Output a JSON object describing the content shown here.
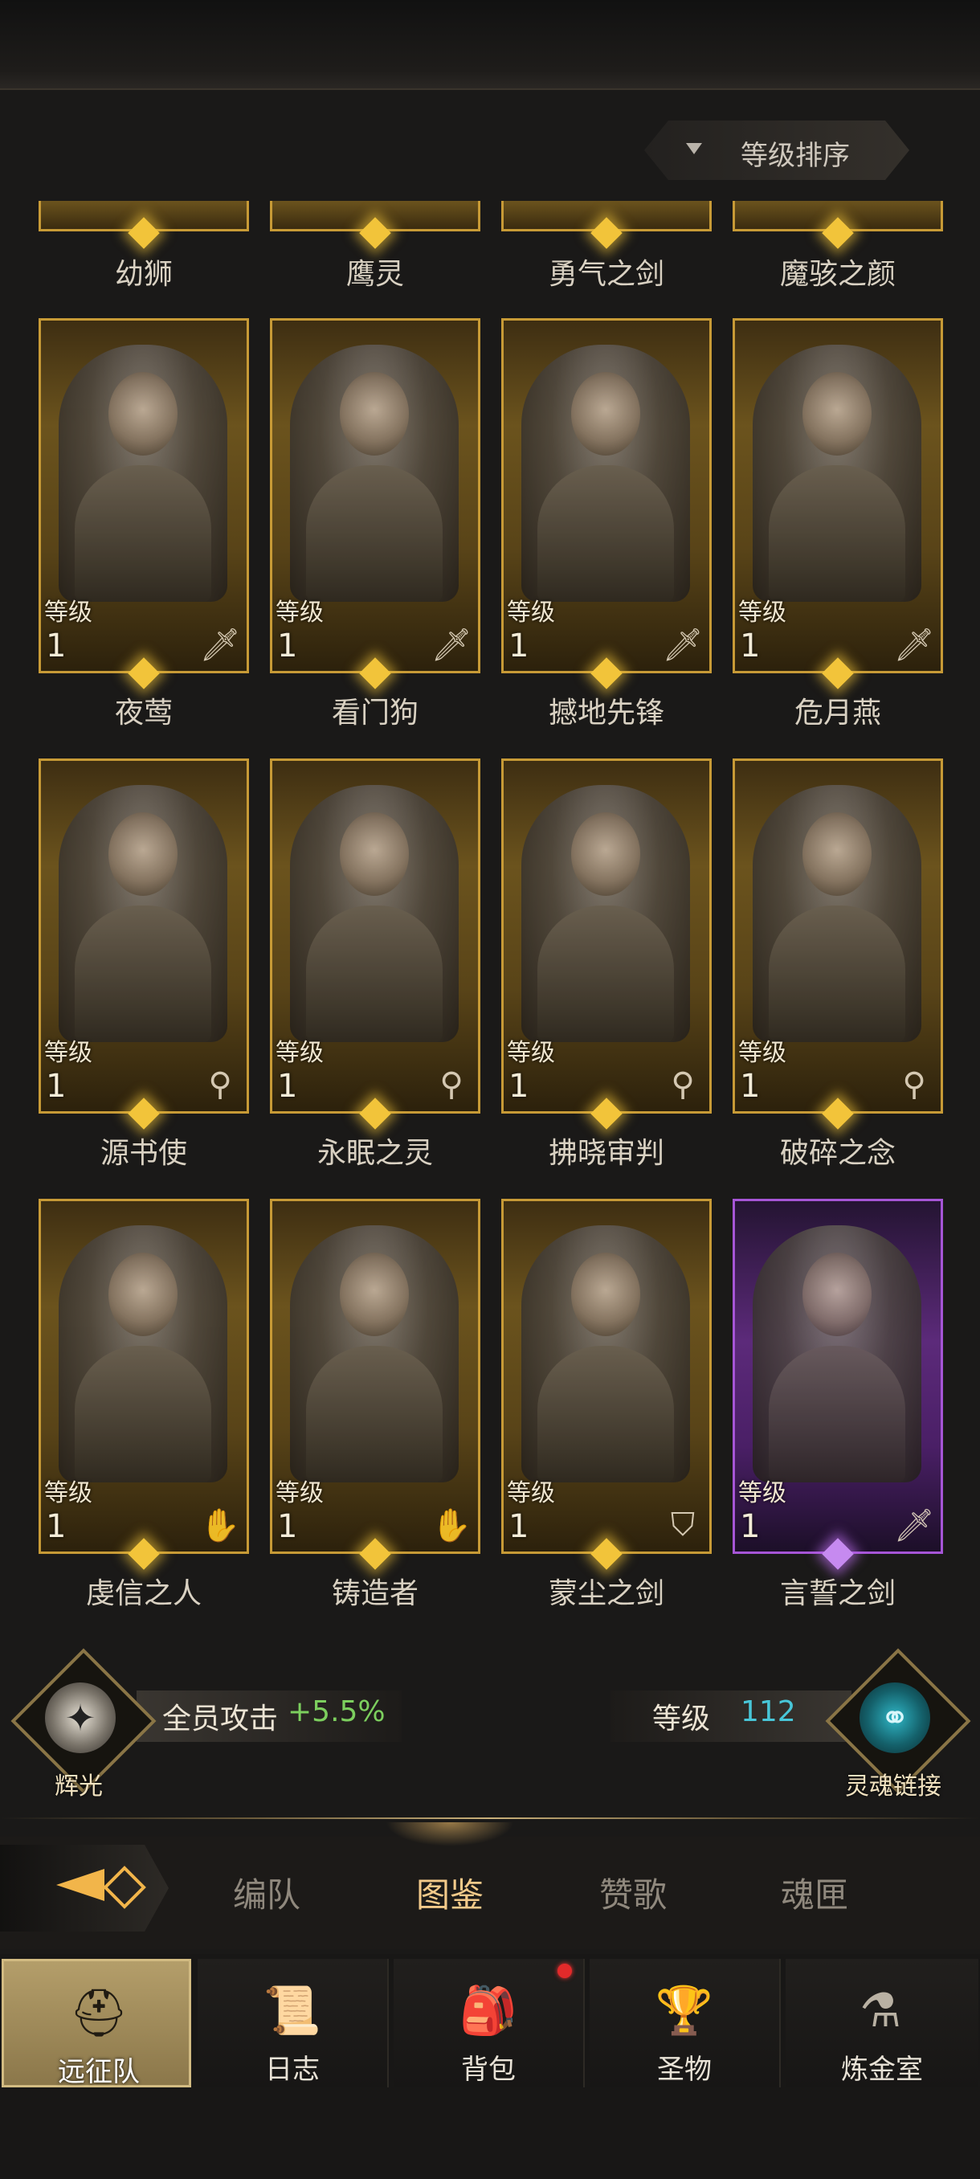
{
  "sort_button": {
    "label": "等级排序"
  },
  "partial_row": {
    "names": [
      "幼狮",
      "鹰灵",
      "勇气之剑",
      "魔骇之颜"
    ]
  },
  "level_label": "等级",
  "cards": [
    {
      "name": "夜莺",
      "level": "1",
      "class_icon": "sword-icon",
      "rarity": "gold"
    },
    {
      "name": "看门狗",
      "level": "1",
      "class_icon": "sword-icon",
      "rarity": "gold"
    },
    {
      "name": "撼地先锋",
      "level": "1",
      "class_icon": "sword-icon",
      "rarity": "gold"
    },
    {
      "name": "危月燕",
      "level": "1",
      "class_icon": "sword-icon",
      "rarity": "gold"
    },
    {
      "name": "源书使",
      "level": "1",
      "class_icon": "staff-icon",
      "rarity": "gold"
    },
    {
      "name": "永眠之灵",
      "level": "1",
      "class_icon": "staff-icon",
      "rarity": "gold"
    },
    {
      "name": "拂晓审判",
      "level": "1",
      "class_icon": "staff-icon",
      "rarity": "gold"
    },
    {
      "name": "破碎之念",
      "level": "1",
      "class_icon": "staff-icon",
      "rarity": "gold"
    },
    {
      "name": "虔信之人",
      "level": "1",
      "class_icon": "hand-icon",
      "rarity": "gold"
    },
    {
      "name": "铸造者",
      "level": "1",
      "class_icon": "hand-icon",
      "rarity": "gold"
    },
    {
      "name": "蒙尘之剑",
      "level": "1",
      "class_icon": "shield-icon",
      "rarity": "gold"
    },
    {
      "name": "言誓之剑",
      "level": "1",
      "class_icon": "sword-icon",
      "rarity": "purple"
    }
  ],
  "bonus_bar": {
    "left_emblem_label": "辉光",
    "attack_label": "全员攻击",
    "attack_value": "+5.5%",
    "level_label": "等级",
    "level_value": "112",
    "right_emblem_label": "灵魂链接"
  },
  "tabs": [
    {
      "label": "编队",
      "active": false
    },
    {
      "label": "图鉴",
      "active": true
    },
    {
      "label": "赞歌",
      "active": false
    },
    {
      "label": "魂匣",
      "active": false
    }
  ],
  "bottom_nav": [
    {
      "label": "远征队",
      "icon": "helmet-icon",
      "active": true
    },
    {
      "label": "日志",
      "icon": "scroll-icon",
      "active": false
    },
    {
      "label": "背包",
      "icon": "backpack-icon",
      "active": false,
      "badge": true
    },
    {
      "label": "圣物",
      "icon": "chalice-icon",
      "active": false
    },
    {
      "label": "炼金室",
      "icon": "alchemy-icon",
      "active": false
    }
  ],
  "colors": {
    "gold_border": "#c79a36",
    "purple_border": "#a655d6",
    "attack_green": "#7ccf5e",
    "level_cyan": "#48c6d8",
    "active_tab": "#f3ca8a"
  }
}
